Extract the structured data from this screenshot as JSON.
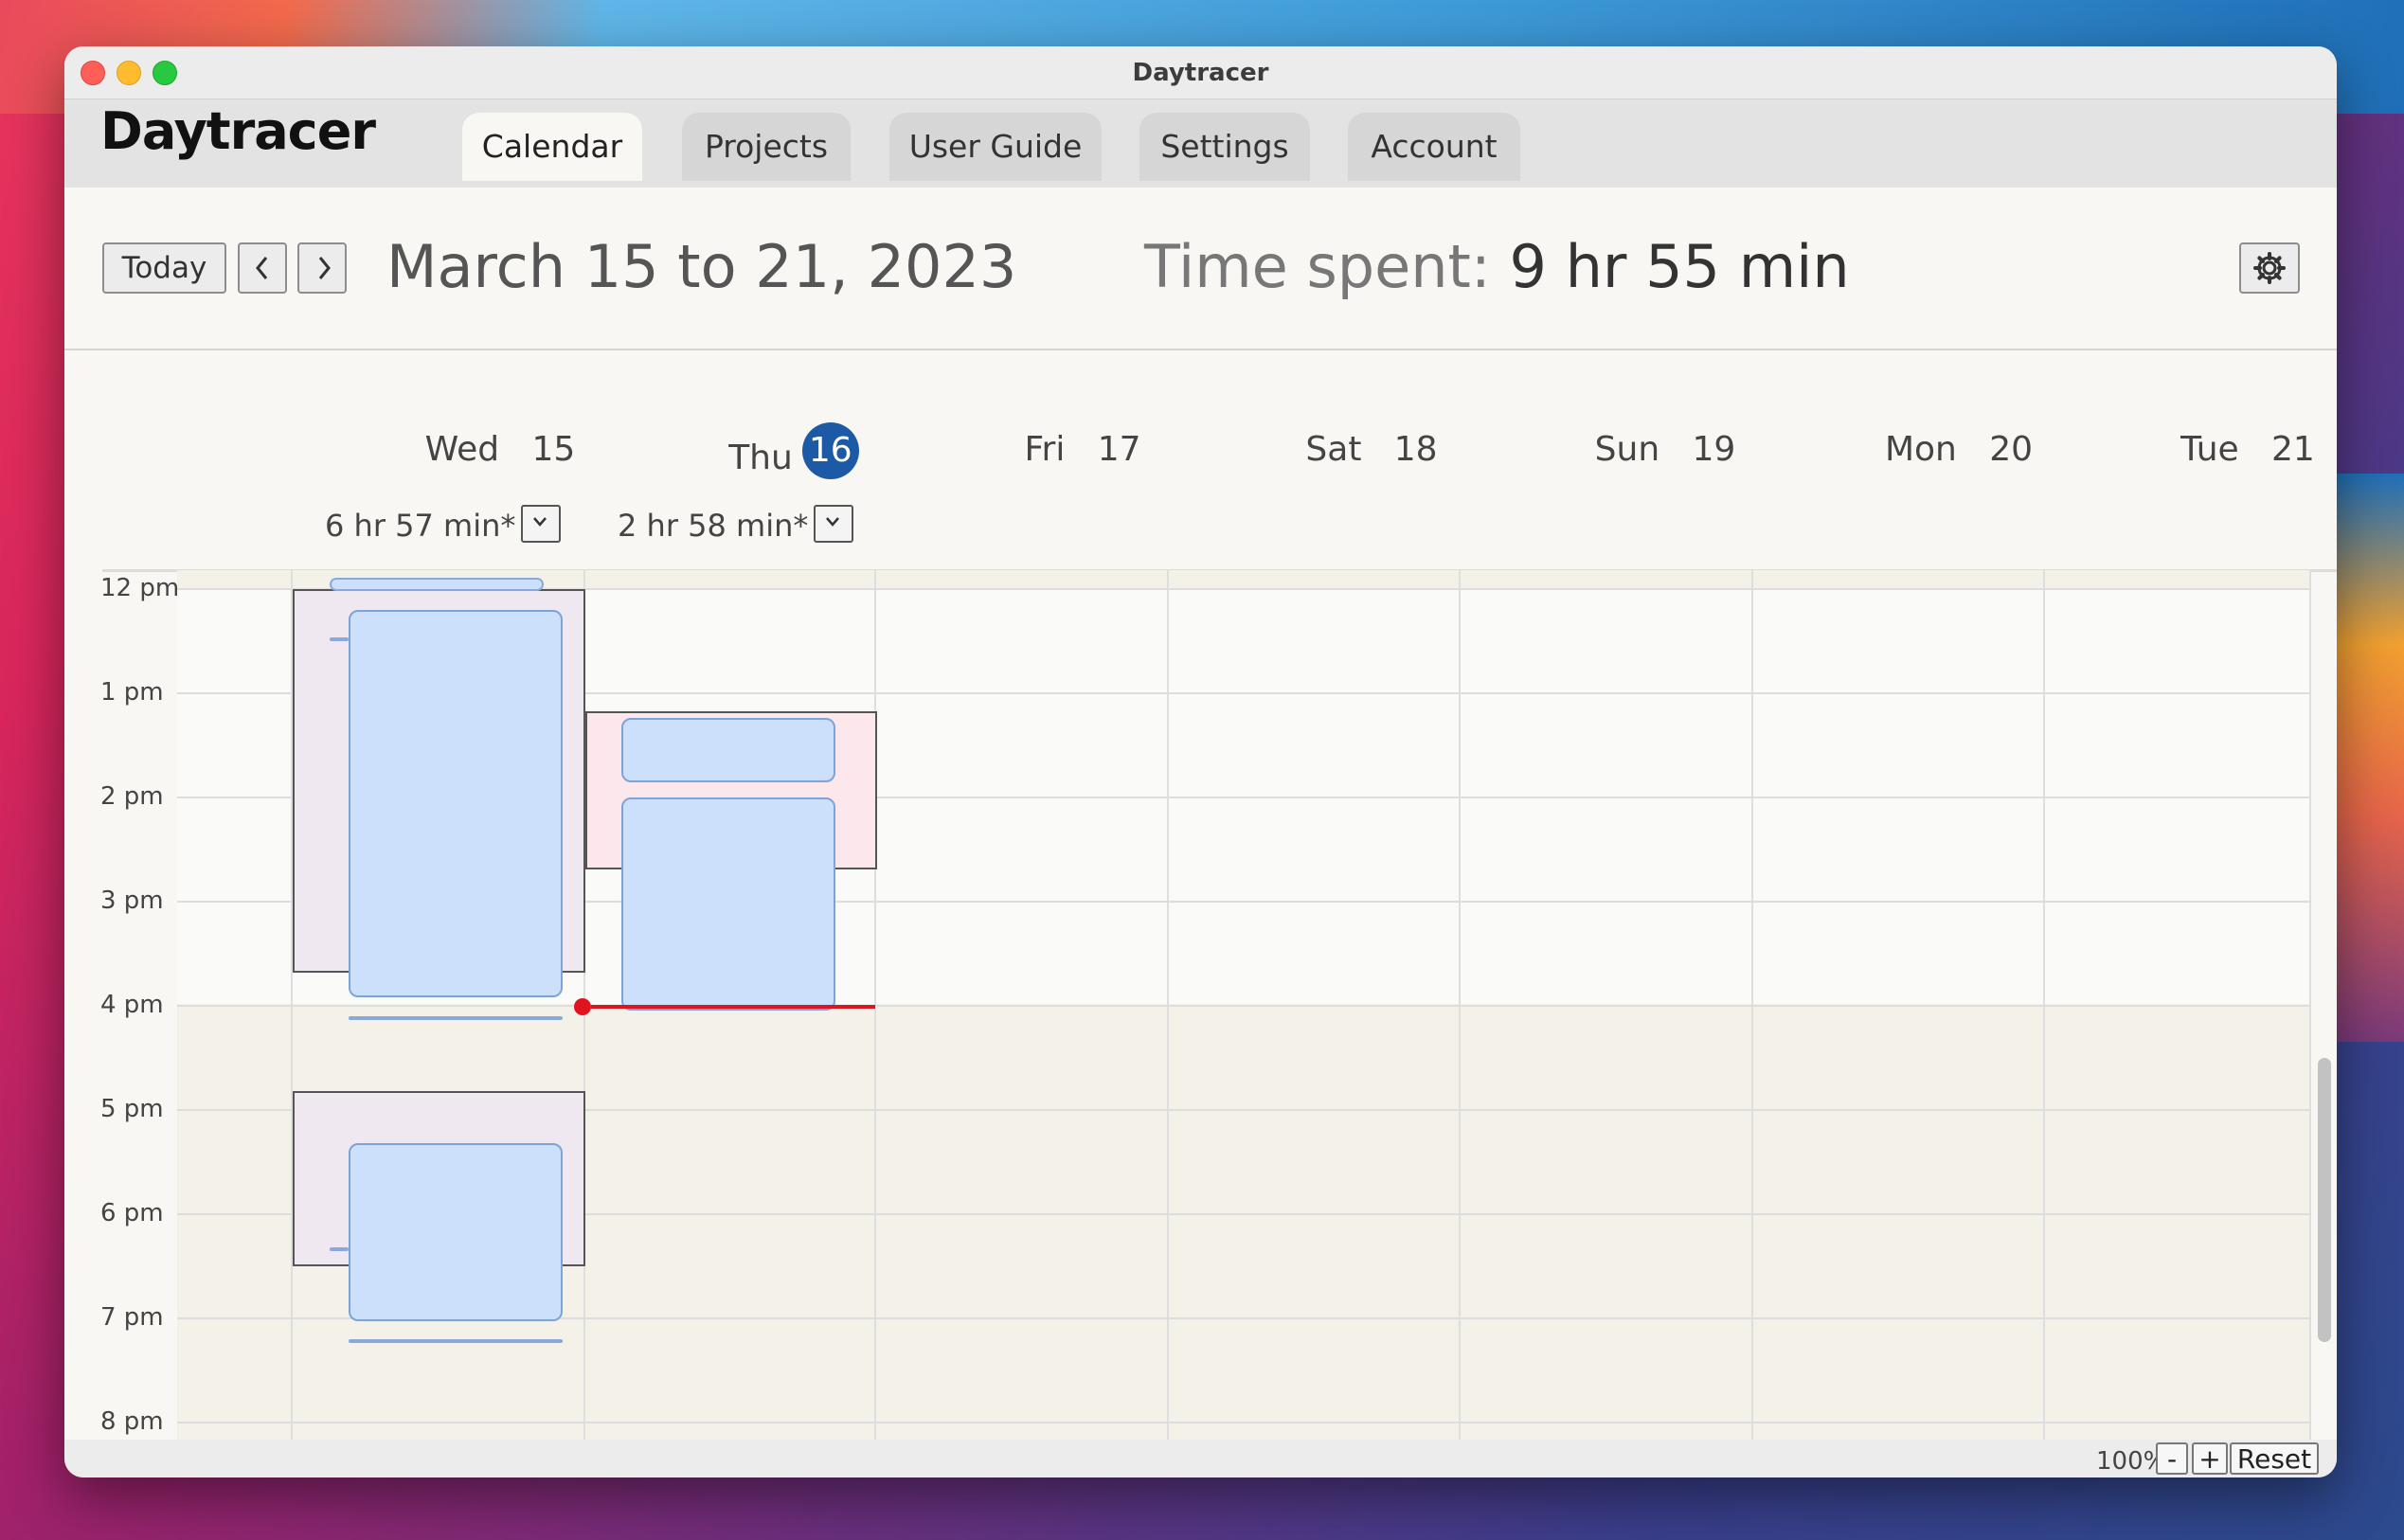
{
  "window": {
    "title": "Daytracer"
  },
  "app": {
    "logo": "Daytracer"
  },
  "tabs": [
    {
      "label": "Calendar",
      "active": true
    },
    {
      "label": "Projects"
    },
    {
      "label": "User Guide"
    },
    {
      "label": "Settings"
    },
    {
      "label": "Account"
    }
  ],
  "toolbar": {
    "today_label": "Today",
    "prev_icon": "chevron-left-icon",
    "next_icon": "chevron-right-icon",
    "date_range": "March 15 to 21, 2023",
    "time_spent_label": "Time spent:",
    "time_spent_value": "9 hr 55 min",
    "settings_icon": "gear-icon"
  },
  "days": [
    {
      "dow": "Wed",
      "date": "15",
      "total": "6 hr 57 min*"
    },
    {
      "dow": "Thu",
      "date": "16",
      "today": true,
      "total": "2 hr 58 min*"
    },
    {
      "dow": "Fri",
      "date": "17"
    },
    {
      "dow": "Sat",
      "date": "18"
    },
    {
      "dow": "Sun",
      "date": "19"
    },
    {
      "dow": "Mon",
      "date": "20"
    },
    {
      "dow": "Tue",
      "date": "21"
    }
  ],
  "hours": [
    "12 pm",
    "1 pm",
    "2 pm",
    "3 pm",
    "4 pm",
    "5 pm",
    "6 pm",
    "7 pm",
    "8 pm"
  ],
  "colors": {
    "today_circle": "#1c5aa6",
    "now_line": "#e0141e",
    "event_fill": "#cde0fb"
  },
  "footer": {
    "zoom": "100%",
    "minus": "-",
    "plus": "+",
    "reset": "Reset"
  }
}
